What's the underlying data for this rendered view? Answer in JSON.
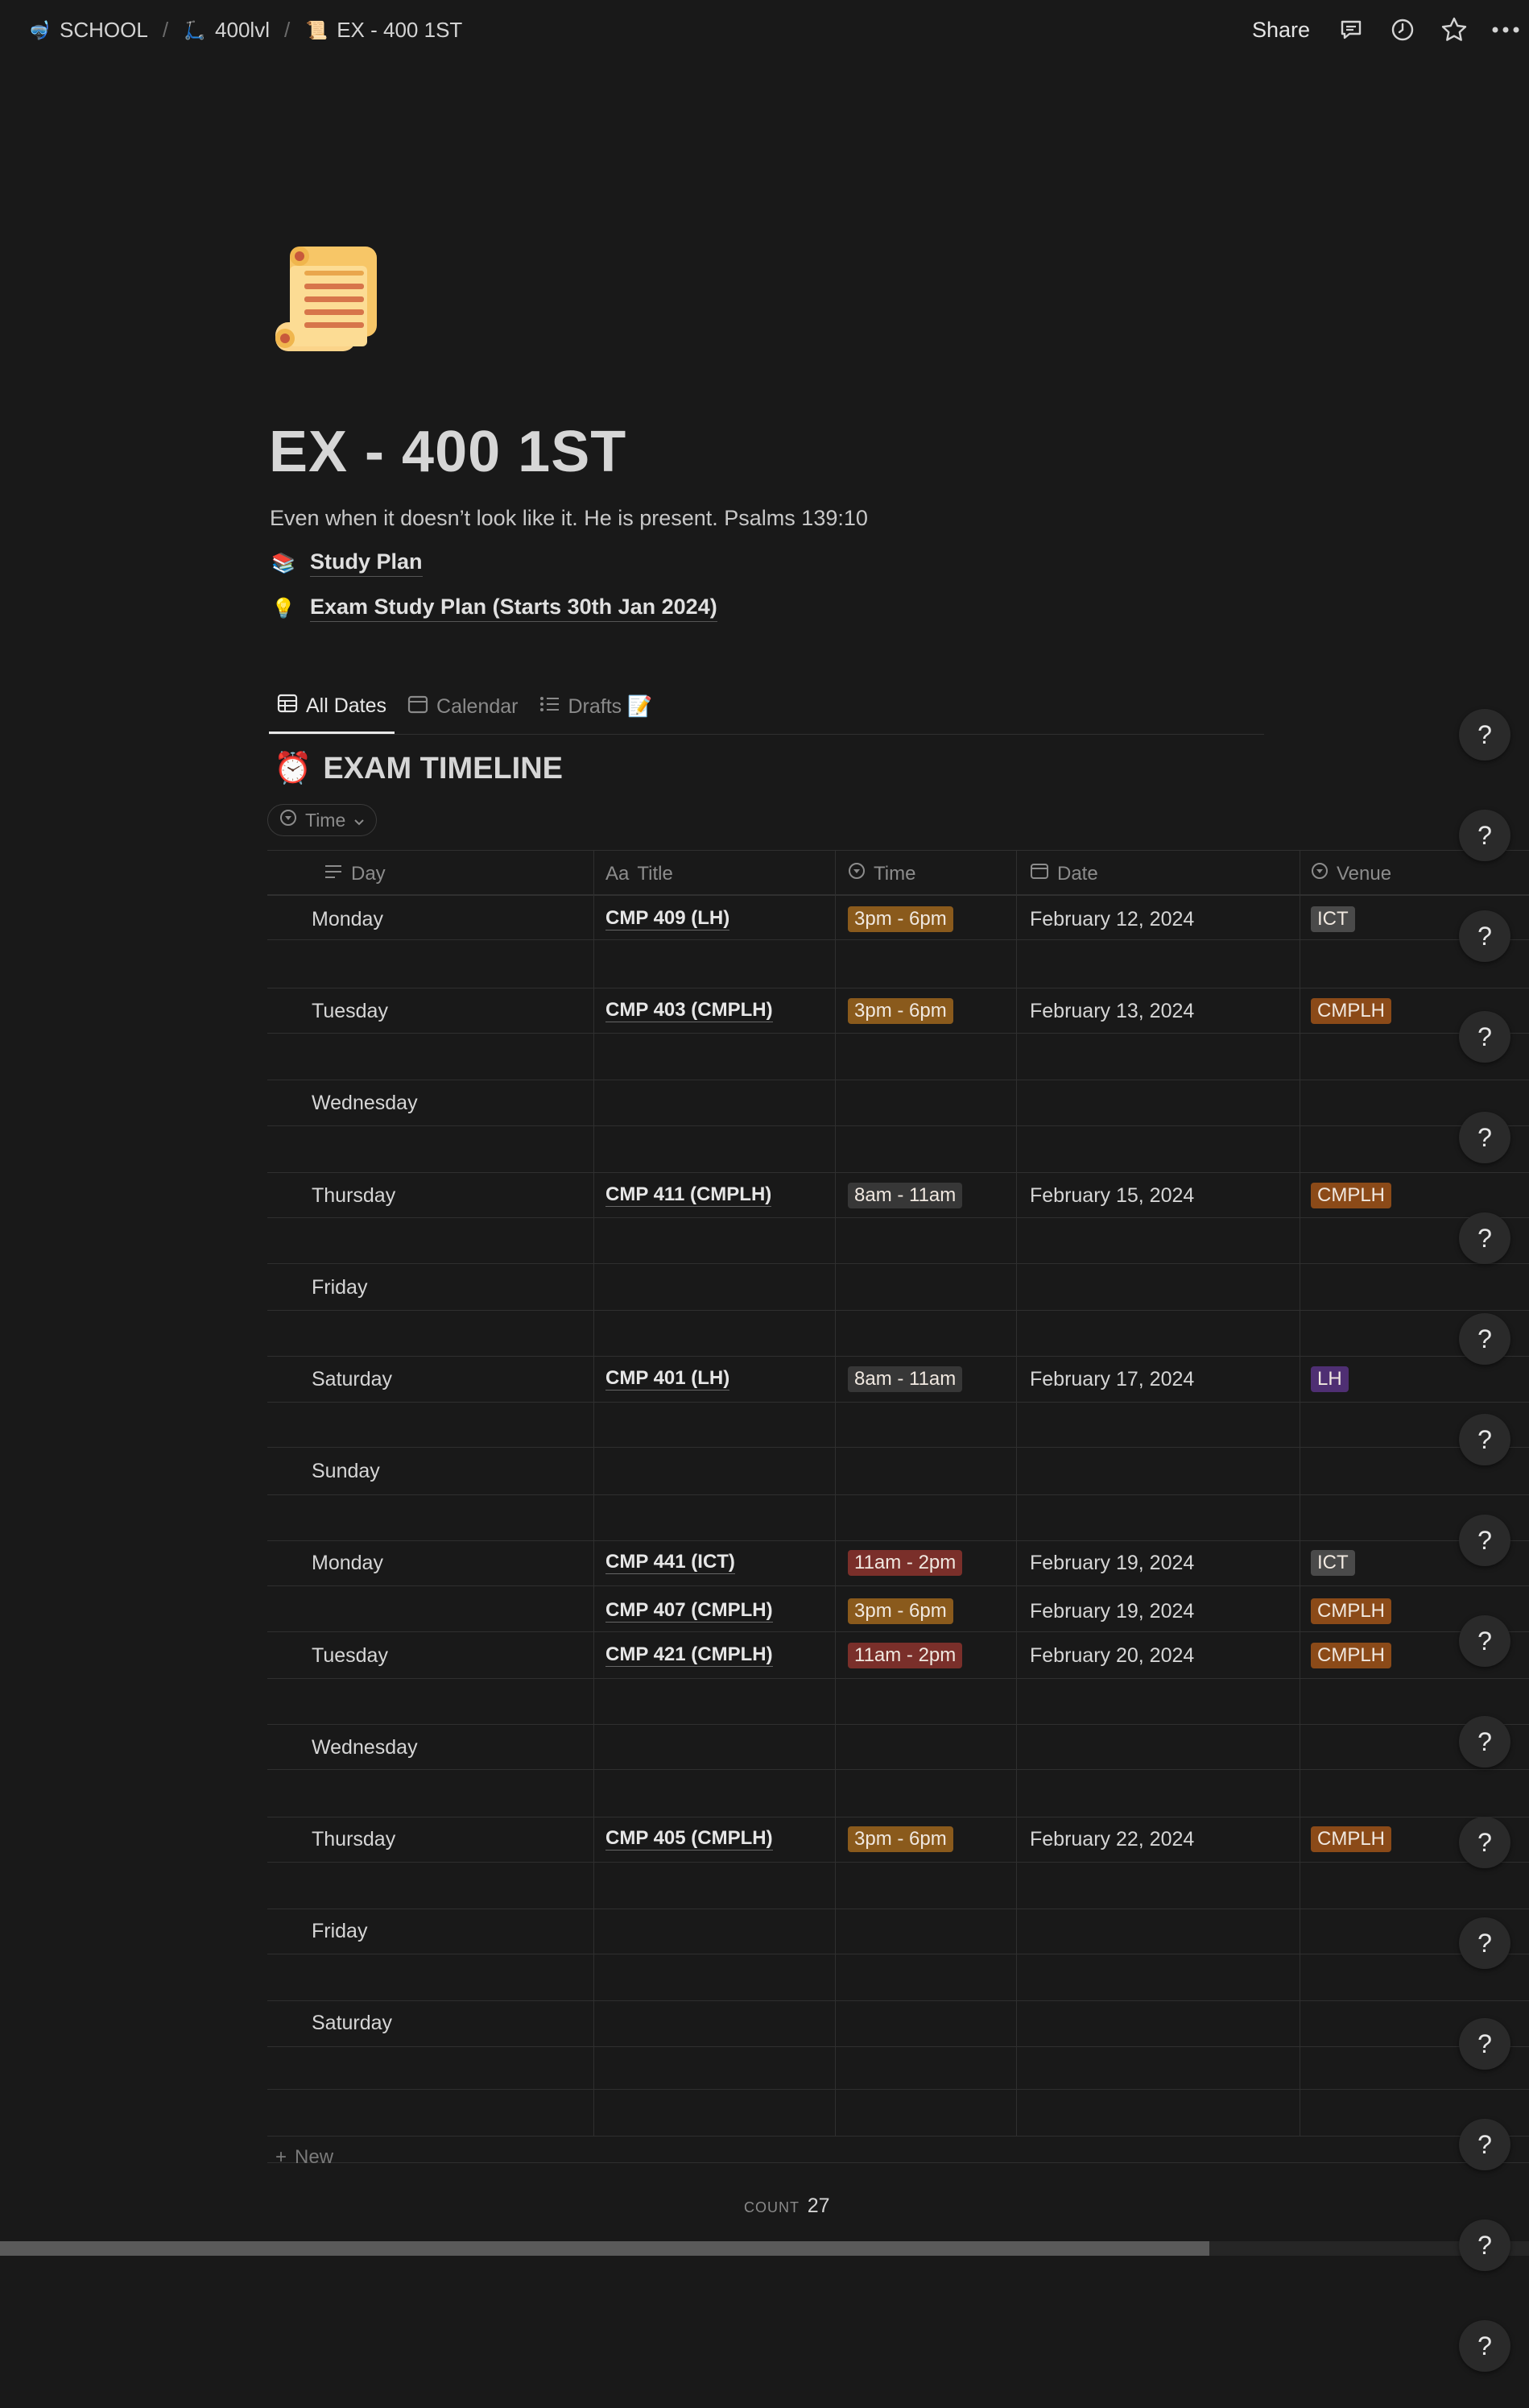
{
  "breadcrumb": [
    {
      "icon": "🤿",
      "label": "SCHOOL"
    },
    {
      "icon": "🛴",
      "label": "400lvl"
    },
    {
      "icon": "📜",
      "label": "EX - 400 1ST"
    }
  ],
  "topbar": {
    "share_label": "Share"
  },
  "page": {
    "icon": "scroll-icon",
    "title": "EX - 400 1ST",
    "quote": "Even when it doesn’t look like it. He is present. Psalms 139:10",
    "links": [
      {
        "icon": "📚",
        "label": "Study Plan"
      },
      {
        "icon": "💡",
        "label": "Exam Study Plan (Starts 30th Jan 2024)"
      }
    ]
  },
  "views": {
    "tabs": [
      {
        "label": "All Dates",
        "icon": "table-icon",
        "active": true
      },
      {
        "label": "Calendar",
        "icon": "calendar-icon",
        "active": false
      },
      {
        "label": "Drafts 📝",
        "icon": "list-icon",
        "active": false
      }
    ]
  },
  "database": {
    "title_emoji": "⏰",
    "title": "EXAM TIMELINE",
    "filter_label": "Time",
    "columns": [
      "Day",
      "Title",
      "Time",
      "Date",
      "Venue"
    ],
    "title_column_prefix": "Aa",
    "new_label": "New",
    "count_label": "COUNT",
    "count_value": "27"
  },
  "rows": [
    {
      "day": "Monday",
      "title": "CMP 409 (LH)",
      "time": "3pm - 6pm",
      "date": "February 12, 2024",
      "venue": "ICT"
    },
    {
      "day": "Tuesday",
      "title": "CMP 403 (CMPLH)",
      "time": "3pm - 6pm",
      "date": "February 13, 2024",
      "venue": "CMPLH"
    },
    {
      "day": "Wednesday",
      "title": "",
      "time": "",
      "date": "",
      "venue": ""
    },
    {
      "day": "Thursday",
      "title": "CMP 411 (CMPLH)",
      "time": "8am - 11am",
      "date": "February 15, 2024",
      "venue": "CMPLH"
    },
    {
      "day": "Friday",
      "title": "",
      "time": "",
      "date": "",
      "venue": ""
    },
    {
      "day": "Saturday",
      "title": "CMP 401 (LH)",
      "time": "8am - 11am",
      "date": "February 17, 2024",
      "venue": "LH"
    },
    {
      "day": "Sunday",
      "title": "",
      "time": "",
      "date": "",
      "venue": ""
    },
    {
      "day": "Monday",
      "title": "CMP 441 (ICT)",
      "time": "11am - 2pm",
      "date": "February 19, 2024",
      "venue": "ICT"
    },
    {
      "day": "",
      "title": "CMP 407 (CMPLH)",
      "time": "3pm - 6pm",
      "date": "February 19, 2024",
      "venue": "CMPLH"
    },
    {
      "day": "Tuesday",
      "title": "CMP 421 (CMPLH)",
      "time": "11am - 2pm",
      "date": "February 20, 2024",
      "venue": "CMPLH"
    },
    {
      "day": "Wednesday",
      "title": "",
      "time": "",
      "date": "",
      "venue": ""
    },
    {
      "day": "Thursday",
      "title": "CMP 405 (CMPLH)",
      "time": "3pm - 6pm",
      "date": "February 22, 2024",
      "venue": "CMPLH"
    },
    {
      "day": "Friday",
      "title": "",
      "time": "",
      "date": "",
      "venue": ""
    },
    {
      "day": "Saturday",
      "title": "",
      "time": "",
      "date": "",
      "venue": ""
    }
  ],
  "colors": {
    "time_3pm": "#8a5a1c",
    "time_8am": "#373737",
    "time_11am": "#7a2f2a",
    "venue_ICT": "#4a4a4a",
    "venue_CMPLH": "#8b4a18",
    "venue_LH": "#4f2f73"
  },
  "help_button_label": "?"
}
